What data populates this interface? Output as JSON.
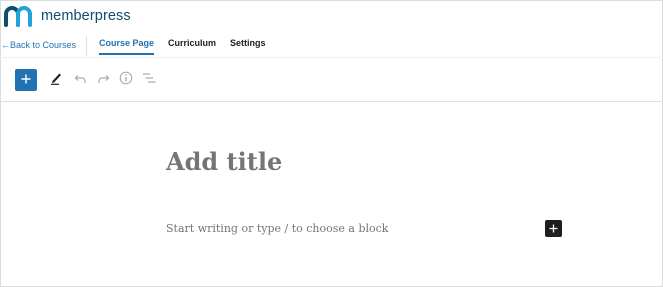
{
  "brand": {
    "name": "memberpress",
    "logo_icon": "memberpress-m-logo",
    "colors": {
      "teal": "#0d4e6e",
      "cyan": "#1fa3d9"
    }
  },
  "nav": {
    "back_label": "←Back to Courses",
    "tabs": [
      {
        "label": "Course Page",
        "active": true
      },
      {
        "label": "Curriculum",
        "active": false
      },
      {
        "label": "Settings",
        "active": false
      }
    ],
    "accent": "#2271b1"
  },
  "toolbar": {
    "buttons": [
      {
        "name": "add-block",
        "icon": "plus-icon"
      },
      {
        "name": "tools",
        "icon": "pencil-icon"
      },
      {
        "name": "undo",
        "icon": "undo-icon"
      },
      {
        "name": "redo",
        "icon": "redo-icon"
      },
      {
        "name": "details",
        "icon": "info-icon"
      },
      {
        "name": "outline",
        "icon": "list-view-icon"
      }
    ]
  },
  "editor": {
    "title_placeholder": "Add title",
    "body_placeholder": "Start writing or type / to choose a block"
  }
}
